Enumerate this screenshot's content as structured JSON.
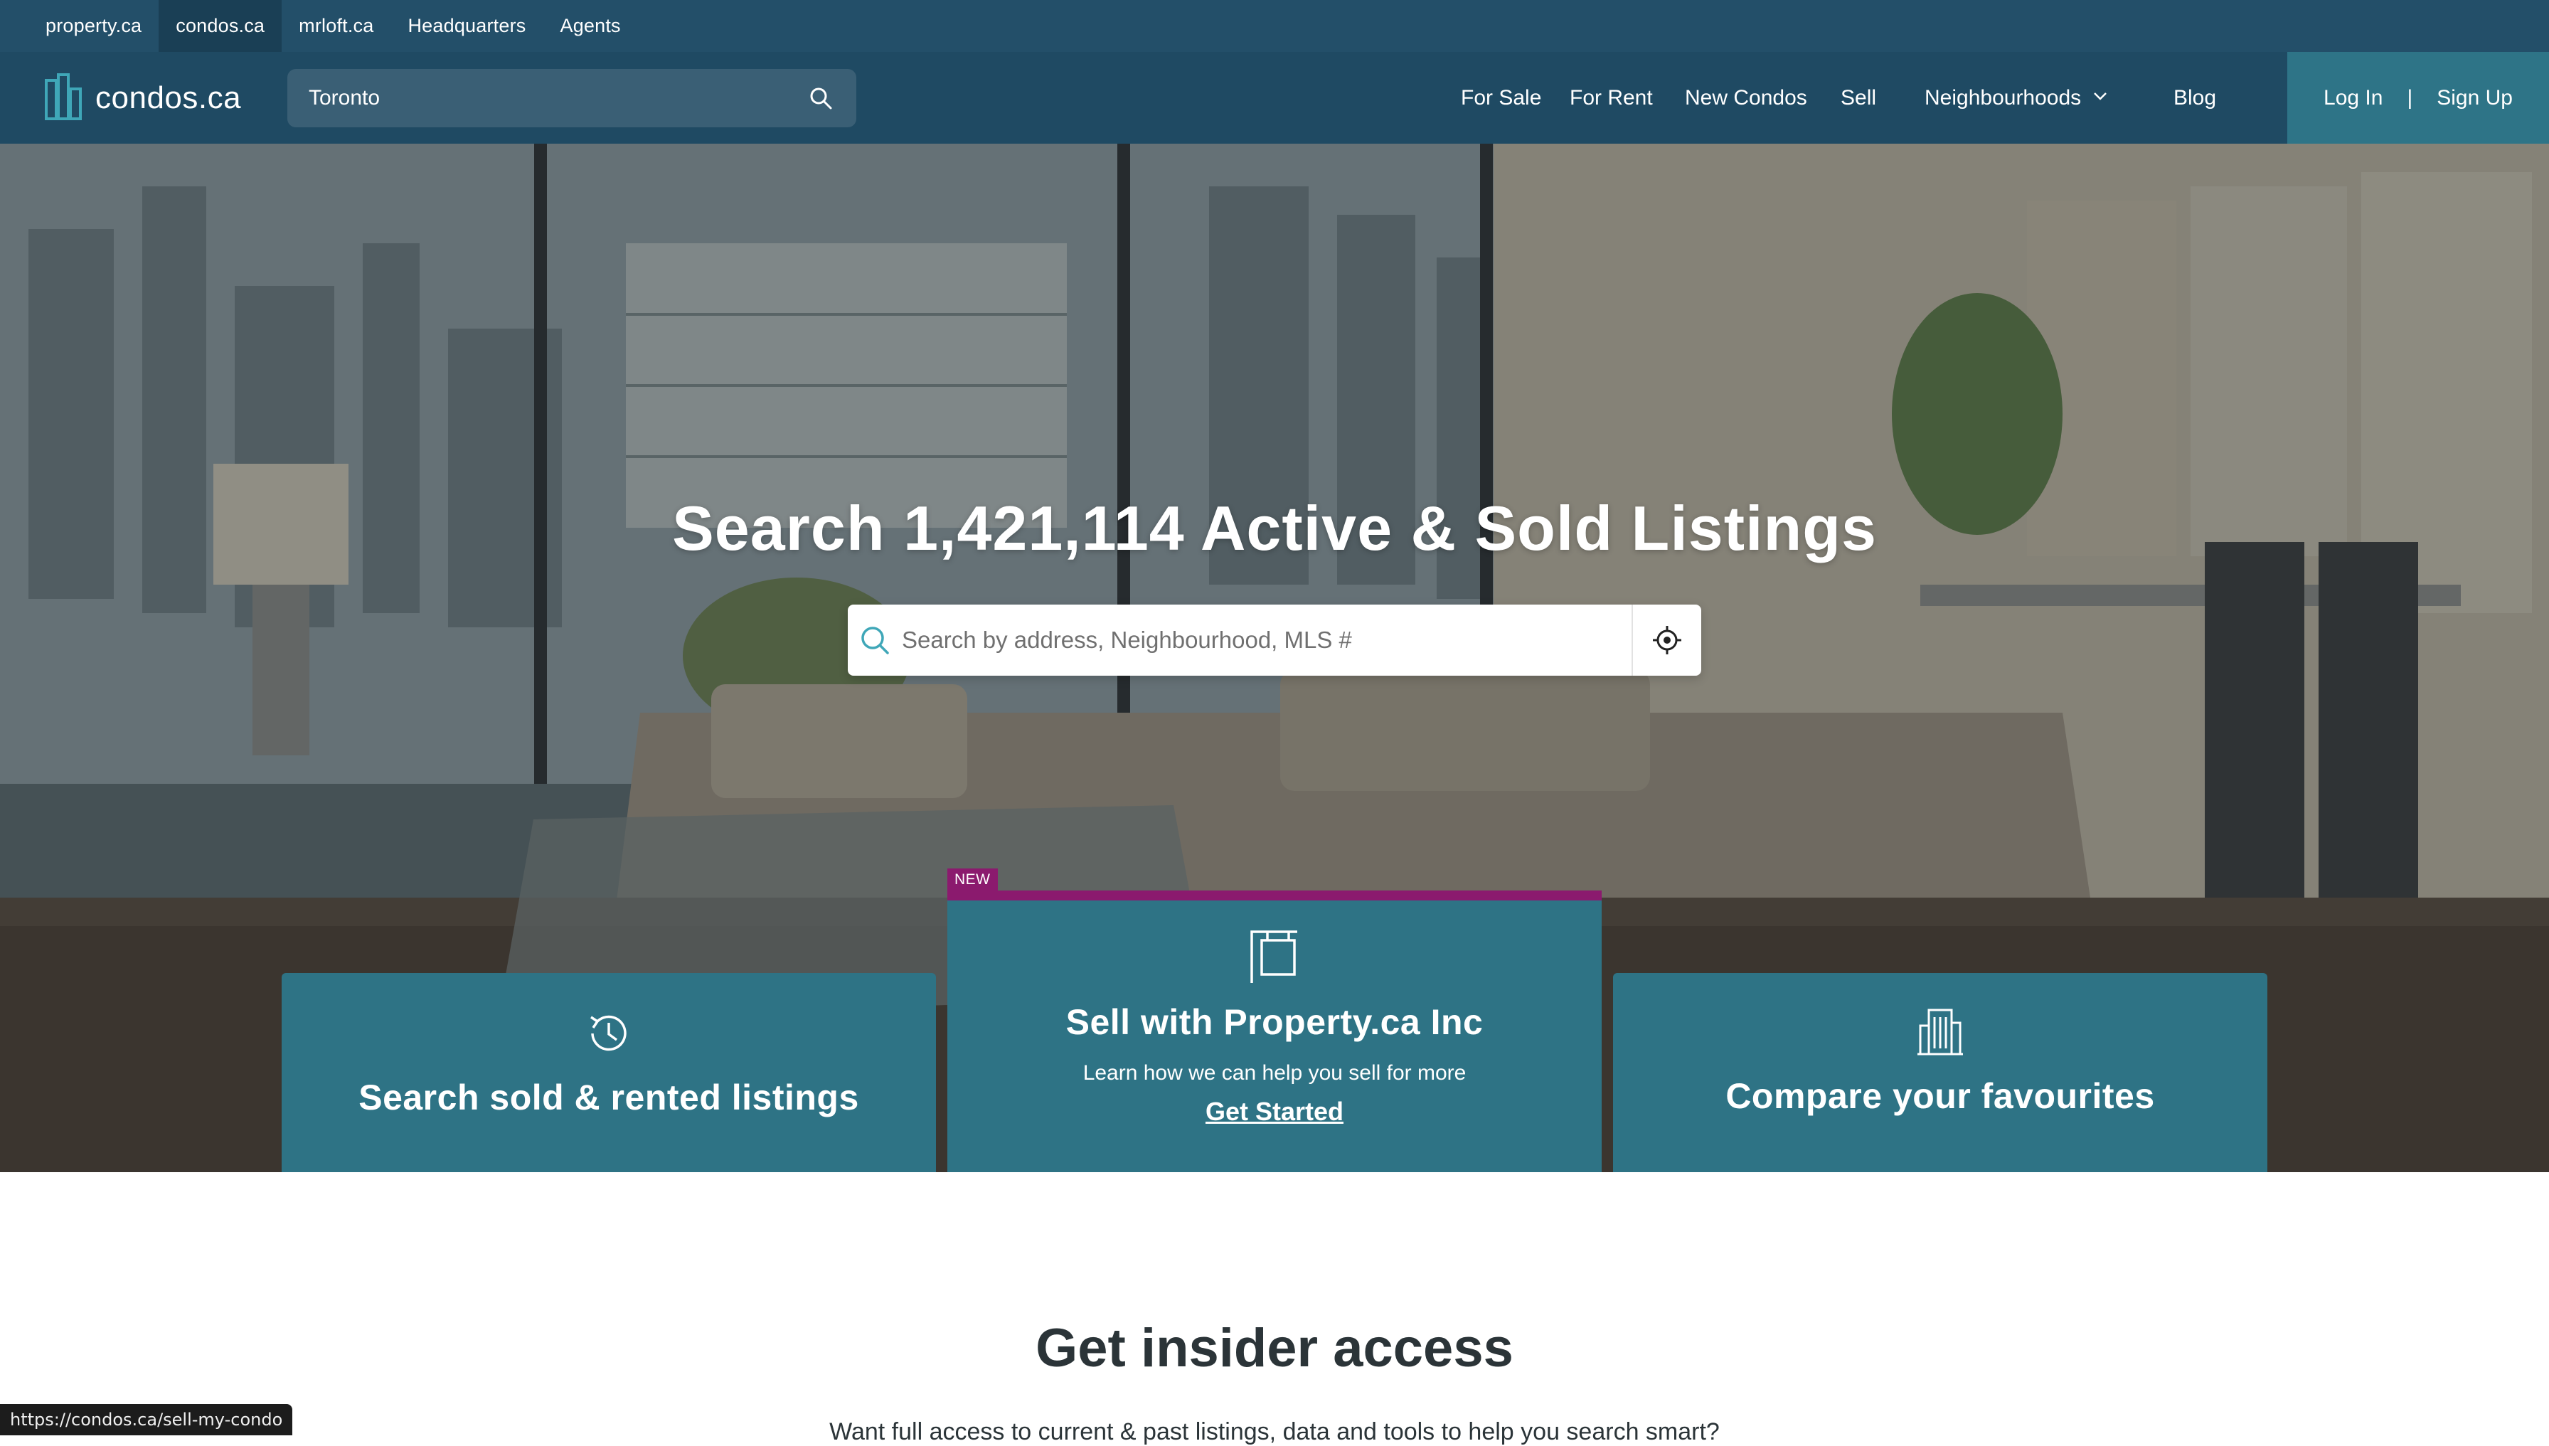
{
  "network_tabs": [
    {
      "label": "property.ca"
    },
    {
      "label": "condos.ca",
      "active": true
    },
    {
      "label": "mrloft.ca"
    },
    {
      "label": "Headquarters"
    },
    {
      "label": "Agents"
    }
  ],
  "header": {
    "logo_text": "condos.ca",
    "search_value": "Toronto",
    "nav": [
      {
        "label": "For Sale"
      },
      {
        "label": "For Rent"
      },
      {
        "label": "New Condos"
      },
      {
        "label": "Sell"
      },
      {
        "label": "Neighbourhoods",
        "has_dropdown": true
      },
      {
        "label": "Blog"
      }
    ],
    "login_label": "Log In",
    "auth_separator": "|",
    "signup_label": "Sign Up"
  },
  "hero": {
    "title": "Search 1,421,114 Active & Sold Listings",
    "search_placeholder": "Search by address, Neighbourhood, MLS #"
  },
  "cards": {
    "left": {
      "icon": "history-icon",
      "title": "Search sold & rented listings"
    },
    "middle": {
      "badge": "NEW",
      "icon": "sign-icon",
      "title": "Sell with Property.ca Inc",
      "subtitle": "Learn how we can help you sell for more",
      "link": "Get Started"
    },
    "right": {
      "icon": "building-icon",
      "title": "Compare your favourites"
    }
  },
  "insider": {
    "title": "Get insider access",
    "subtitle": "Want full access to current & past listings, data and tools to help you search smart?"
  },
  "status_bar_url": "https://condos.ca/sell-my-condo",
  "colors": {
    "topbar": "#234f69",
    "header": "#1f4a63",
    "card": "#2e7385",
    "new_badge": "#8b1a6e",
    "accent": "#3fa7b8"
  }
}
